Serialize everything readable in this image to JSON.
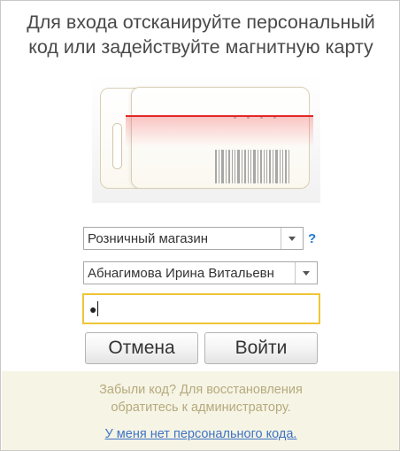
{
  "header": {
    "title_line1": "Для входа отсканируйте персональный",
    "title_line2": "код или задействуйте магнитную карту"
  },
  "illustration": {
    "name": "scan-card-illustration",
    "laser_color": "#e02727"
  },
  "form": {
    "store": {
      "value": "Розничный магазин"
    },
    "store_help": "?",
    "user": {
      "value": "Абнагимова Ирина Витальевн"
    },
    "password": {
      "masked_value": "●"
    }
  },
  "buttons": {
    "cancel_label": "Отмена",
    "login_label": "Войти"
  },
  "footer": {
    "message_line1": "Забыли код? Для восстановления",
    "message_line2": "обратитесь к администратору.",
    "no_code_link": "У меня нет персонального кода."
  },
  "colors": {
    "focus_border": "#f0c537",
    "link": "#3d73c5",
    "footer_bg": "#f6f4e5",
    "footer_text": "#b5aa7d"
  }
}
